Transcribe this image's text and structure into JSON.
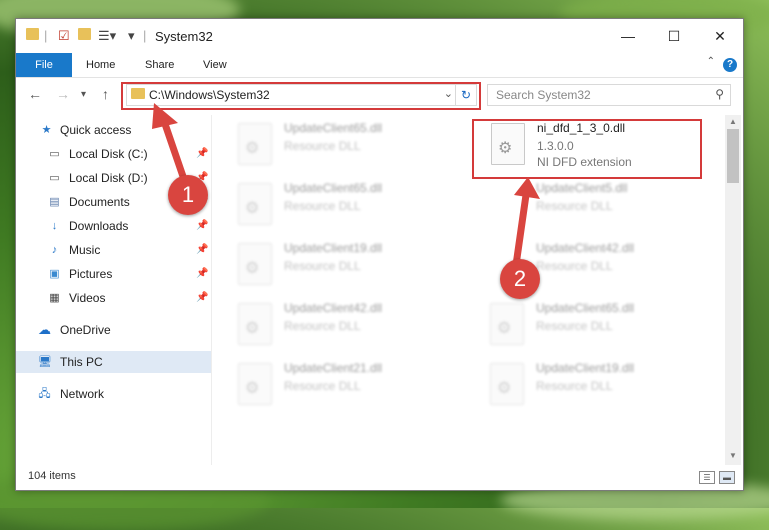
{
  "window": {
    "title": "System32",
    "minimize_glyph": "—",
    "maximize_glyph": "☐",
    "close_glyph": "✕"
  },
  "ribbon": {
    "tabs": [
      {
        "label": "File"
      },
      {
        "label": "Home"
      },
      {
        "label": "Share"
      },
      {
        "label": "View"
      }
    ],
    "help_glyph": "?",
    "expand_glyph": "⌃"
  },
  "navbar": {
    "address": "C:\\Windows\\System32",
    "search_placeholder": "Search System32"
  },
  "sidebar": {
    "items": [
      {
        "label": "Quick access",
        "icon": "star-icon",
        "pinned": false
      },
      {
        "label": "Local Disk (C:)",
        "icon": "drive-icon",
        "pinned": true
      },
      {
        "label": "Local Disk (D:)",
        "icon": "drive-icon",
        "pinned": true
      },
      {
        "label": "Documents",
        "icon": "documents-icon",
        "pinned": true
      },
      {
        "label": "Downloads",
        "icon": "download-icon",
        "pinned": true
      },
      {
        "label": "Music",
        "icon": "music-icon",
        "pinned": true
      },
      {
        "label": "Pictures",
        "icon": "pictures-icon",
        "pinned": true
      },
      {
        "label": "Videos",
        "icon": "videos-icon",
        "pinned": true
      },
      {
        "label": "OneDrive",
        "icon": "cloud-icon",
        "pinned": false
      },
      {
        "label": "This PC",
        "icon": "computer-icon",
        "pinned": false,
        "selected": true
      },
      {
        "label": "Network",
        "icon": "network-icon",
        "pinned": false
      }
    ]
  },
  "files": {
    "left_column": [
      {
        "name": "UpdateClient65.dll",
        "type": "Resource DLL"
      },
      {
        "name": "UpdateClient65.dll",
        "type": "Resource DLL"
      },
      {
        "name": "UpdateClient19.dll",
        "type": "Resource DLL"
      },
      {
        "name": "UpdateClient42.dll",
        "type": "Resource DLL"
      },
      {
        "name": "UpdateClient21.dll",
        "type": "Resource DLL"
      }
    ],
    "highlighted": {
      "name": "ni_dfd_1_3_0.dll",
      "version": "1.3.0.0",
      "description": "NI DFD extension"
    },
    "right_column": [
      {
        "name": "UpdateClient5.dll",
        "type": "Resource DLL"
      },
      {
        "name": "UpdateClient42.dll",
        "type": "Resource DLL"
      },
      {
        "name": "UpdateClient65.dll",
        "type": "Resource DLL"
      },
      {
        "name": "UpdateClient19.dll",
        "type": "Resource DLL"
      }
    ]
  },
  "status": {
    "item_count": "104 items"
  },
  "annotations": {
    "step1": "1",
    "step2": "2",
    "highlight_color": "#d43a3a"
  }
}
